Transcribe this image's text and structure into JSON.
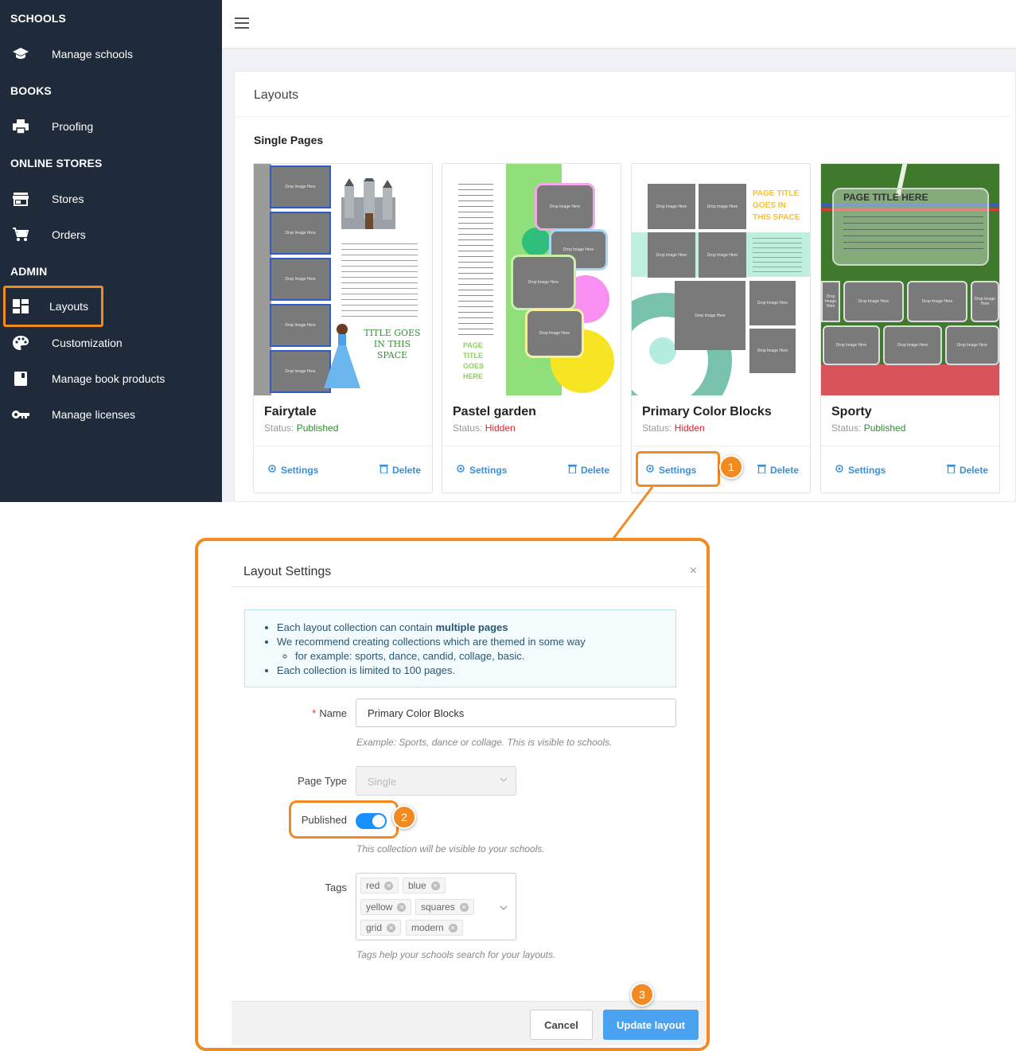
{
  "sidebar": {
    "sections": [
      "SCHOOLS",
      "BOOKS",
      "ONLINE STORES",
      "ADMIN"
    ],
    "items": [
      {
        "label": "Manage schools",
        "icon": "school-icon"
      },
      {
        "label": "Proofing",
        "icon": "printer-icon"
      },
      {
        "label": "Stores",
        "icon": "store-icon"
      },
      {
        "label": "Orders",
        "icon": "cart-icon"
      },
      {
        "label": "Layouts",
        "icon": "dashboard-icon",
        "active": true
      },
      {
        "label": "Customization",
        "icon": "palette-icon"
      },
      {
        "label": "Manage book products",
        "icon": "book-icon"
      },
      {
        "label": "Manage licenses",
        "icon": "key-icon"
      }
    ]
  },
  "panel": {
    "title": "Layouts",
    "section": "Single Pages"
  },
  "cards": [
    {
      "name": "Fairytale",
      "status_label": "Status:",
      "status": "Published",
      "settings": "Settings",
      "delete": "Delete",
      "thumb_text": {
        "drop": "Drop Image Here",
        "title": "TITLE GOES IN THIS SPACE"
      }
    },
    {
      "name": "Pastel garden",
      "status_label": "Status:",
      "status": "Hidden",
      "settings": "Settings",
      "delete": "Delete",
      "thumb_text": {
        "drop": "Drop Image Here",
        "title": "PAGE TITLE GOES HERE"
      }
    },
    {
      "name": "Primary Color Blocks",
      "status_label": "Status:",
      "status": "Hidden",
      "settings": "Settings",
      "delete": "Delete",
      "thumb_text": {
        "drop": "Drop Image Here",
        "title": "PAGE TITLE GOES IN THIS SPACE"
      }
    },
    {
      "name": "Sporty",
      "status_label": "Status:",
      "status": "Published",
      "settings": "Settings",
      "delete": "Delete",
      "thumb_text": {
        "drop": "Drop Image Here",
        "title": "PAGE TITLE HERE"
      }
    }
  ],
  "callouts": [
    "1",
    "2",
    "3"
  ],
  "modal": {
    "title": "Layout Settings",
    "close": "×",
    "info": {
      "line1_prefix": "Each layout collection can contain ",
      "line1_bold": "multiple pages",
      "line2": "We recommend creating collections which are themed in some way",
      "line2_sub": "for example: sports, dance, candid, collage, basic.",
      "line3": "Each collection is limited to 100 pages."
    },
    "name_label": "Name",
    "name_required": "*",
    "name_value": "Primary Color Blocks",
    "name_help": "Example: Sports, dance or collage. This is visible to schools.",
    "page_type_label": "Page Type",
    "page_type_value": "Single",
    "published_label": "Published",
    "published_on": true,
    "published_help": "This collection will be visible to your schools.",
    "tags_label": "Tags",
    "tags": [
      "red",
      "blue",
      "yellow",
      "squares",
      "grid",
      "modern"
    ],
    "tags_help": "Tags help your schools search for your layouts.",
    "cancel": "Cancel",
    "update": "Update layout"
  },
  "colors": {
    "sidebar": "#1f2a3b",
    "accent": "#f28a22",
    "link": "#3a8fdc",
    "published": "#2e8b2e",
    "hidden": "#d9232a",
    "primary_button": "#4aa3f0"
  }
}
